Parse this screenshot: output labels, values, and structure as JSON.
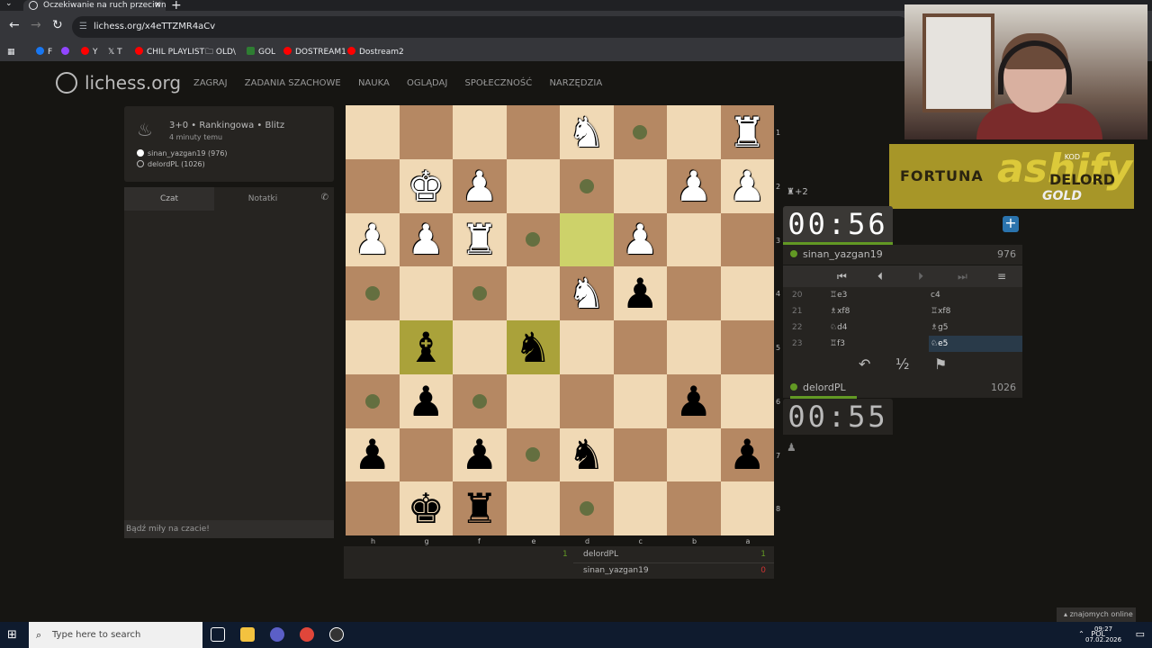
{
  "browser": {
    "tab_title": "Oczekiwanie na ruch przeciwnika",
    "url": "lichess.org/x4eTTZMR4aCv",
    "bookmarks": [
      {
        "label": "F",
        "color": "#1877f2"
      },
      {
        "label": "",
        "color": "#9146ff"
      },
      {
        "label": "Y",
        "color": "#ff0000"
      },
      {
        "label": "T",
        "color": "#ffffff"
      },
      {
        "label": "CHIL PLAYLIST",
        "color": "#ff0000"
      },
      {
        "label": "OLD\\",
        "color": "#bbbbbb"
      },
      {
        "label": "GOL",
        "color": "#2e7d32"
      },
      {
        "label": "DOSTREAM1",
        "color": "#ff0000"
      },
      {
        "label": "Dostream2",
        "color": "#ff0000"
      }
    ]
  },
  "site": {
    "logo": "lichess.org",
    "nav": [
      "ZAGRAJ",
      "ZADANIA SZACHOWE",
      "NAUKA",
      "OGLĄDAJ",
      "SPOŁECZNOŚĆ",
      "NARZĘDZIA"
    ]
  },
  "game_info": {
    "type": "3+0 • Rankingowa • Blitz",
    "time_ago": "4 minuty temu",
    "white_player": "sinan_yazgan19 (976)",
    "black_player": "delordPL (1026)"
  },
  "chat": {
    "tab_chat": "Czat",
    "tab_notes": "Notatki",
    "placeholder": "Bądź miły na czacie!"
  },
  "board": {
    "files": [
      "h",
      "g",
      "f",
      "e",
      "d",
      "c",
      "b",
      "a"
    ],
    "ranks": [
      "1",
      "2",
      "3",
      "4",
      "5",
      "6",
      "7",
      "8"
    ],
    "squares": [
      [
        "",
        "",
        "",
        "",
        "wN",
        "",
        "",
        "wR"
      ],
      [
        "",
        "wK",
        "wP",
        "",
        "",
        "",
        "wP",
        "wP"
      ],
      [
        "wP",
        "wP",
        "wR",
        "",
        "",
        "wP",
        "",
        ""
      ],
      [
        "",
        "",
        "",
        "",
        "wN",
        "bP",
        "",
        ""
      ],
      [
        "",
        "bB",
        "",
        "bN",
        "",
        "",
        "",
        ""
      ],
      [
        "",
        "bP",
        "",
        "",
        "",
        "",
        "bP",
        ""
      ],
      [
        "bP",
        "",
        "bP",
        "",
        "bN",
        "",
        "",
        "bP"
      ],
      [
        "",
        "bK",
        "bR",
        "",
        "",
        "",
        "",
        ""
      ]
    ],
    "highlights": [
      [
        2,
        4
      ],
      [
        4,
        1
      ],
      [
        4,
        3
      ]
    ],
    "move_dots": [
      [
        0,
        5
      ],
      [
        1,
        4
      ],
      [
        2,
        3
      ],
      [
        3,
        0
      ],
      [
        3,
        2
      ],
      [
        5,
        0
      ],
      [
        5,
        2
      ],
      [
        6,
        3
      ],
      [
        7,
        4
      ]
    ]
  },
  "score": {
    "player1": "delordPL",
    "player1_score_left": "1",
    "player1_score_right": "1",
    "player2": "sinan_yazgan19",
    "player2_score": "0"
  },
  "sponsor": {
    "brand1": "FORTUNA",
    "brand2": "ashify",
    "code_label": "KOD",
    "code_name": "DELORD",
    "code_tier": "GOLD"
  },
  "right_panel": {
    "material_top": "+2",
    "clock_top": "00:56",
    "player_top": "sinan_yazgan19",
    "rating_top": "976",
    "moves": [
      {
        "no": "20",
        "white": "♖e3",
        "black": "c4"
      },
      {
        "no": "21",
        "white": "♗xf8",
        "black": "♖xf8"
      },
      {
        "no": "22",
        "white": "♘d4",
        "black": "♗g5"
      },
      {
        "no": "23",
        "white": "♖f3",
        "black": "♘e5"
      }
    ],
    "current_move_index": 3,
    "player_bottom": "delordPL",
    "rating_bottom": "1026",
    "clock_bottom": "00:55",
    "draw_label": "½"
  },
  "friends": "znajomych online",
  "taskbar": {
    "search_placeholder": "Type here to search",
    "lang": "POL",
    "time": "09:27",
    "date": "07.02.2026"
  }
}
